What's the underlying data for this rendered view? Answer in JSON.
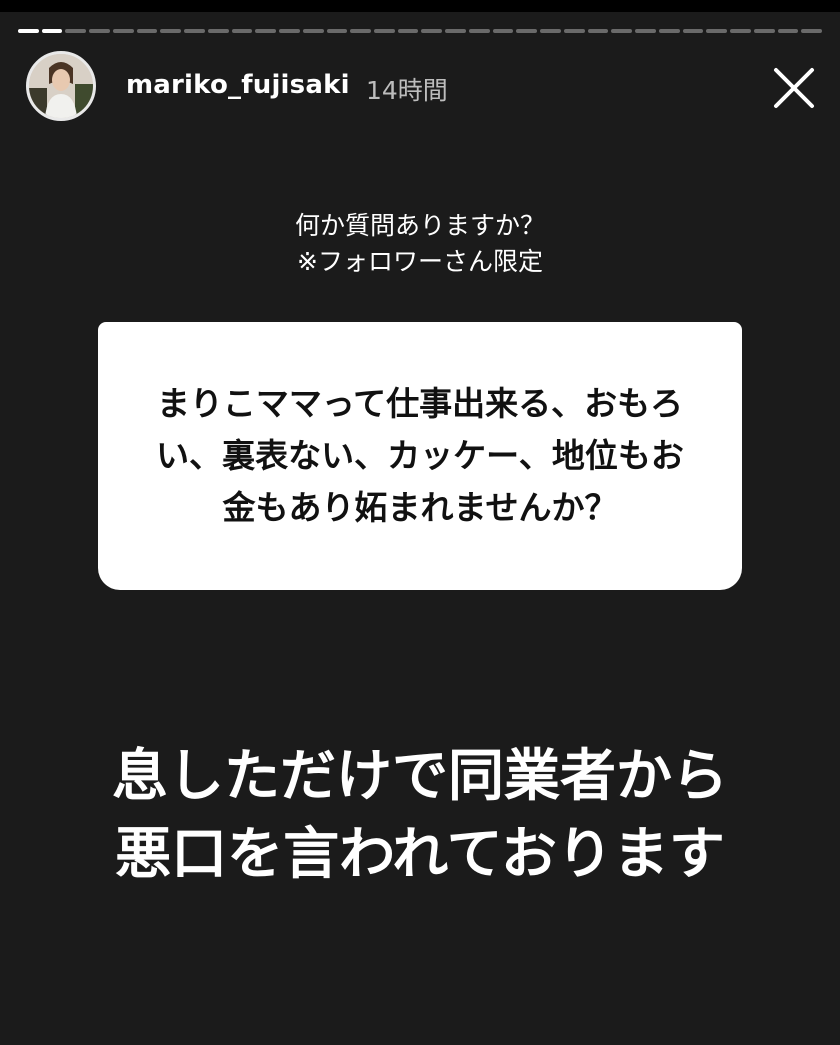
{
  "story": {
    "progress_segments_total": 34,
    "progress_segments_viewed": 2
  },
  "header": {
    "username": "mariko_fujisaki",
    "time": "14時間",
    "avatar_icon": "profile-avatar",
    "close_icon": "close-x-icon"
  },
  "question_sticker": {
    "prompt_line1": "何か質問ありますか？",
    "prompt_line2": "※フォロワーさん限定",
    "question": "まりこママって仕事出来る、おもろい、裏表ない、カッケー、地位もお金もあり妬まれませんか？"
  },
  "answer": {
    "line1": "息しただけで同業者から",
    "line2": "悪口を言われております"
  },
  "colors": {
    "background": "#1b1b1b",
    "card": "#ffffff",
    "card_text": "#111111",
    "text": "#ffffff",
    "muted": "#bdbdbd"
  }
}
